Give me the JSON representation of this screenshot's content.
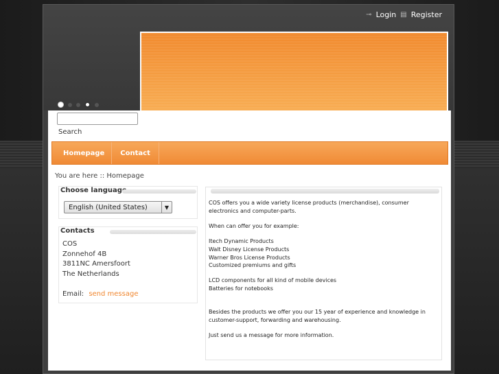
{
  "toplinks": {
    "login": "Login",
    "register": "Register"
  },
  "search": {
    "label": "Search",
    "placeholder": ""
  },
  "nav": {
    "items": [
      "Homepage",
      "Contact"
    ]
  },
  "breadcrumb": {
    "text": "You are here :: Homepage"
  },
  "language": {
    "title": "Choose language",
    "selected": "English (United States)"
  },
  "contacts": {
    "title": "Contacts",
    "lines": [
      "COS",
      "Zonnehof 4B",
      "3811NC  Amersfoort",
      "The Netherlands"
    ],
    "email_label": "Email:",
    "email_link": "send message"
  },
  "main": {
    "paragraphs": [
      "COS offers you a wide variety license products (merchandise), consumer electronics and computer-parts.",
      "When can offer you for example:",
      "Itech Dynamic Products",
      "Walt Disney License Products",
      "Warner Bros License Products",
      "Customized premiums and gifts",
      "LCD components for all kind of mobile devices",
      "Batteries for notebooks",
      "Besides the products we offer you our 15 year of experience and knowledge in customer-support, forwarding and  warehousing.",
      "Just send us a message for more information."
    ]
  },
  "colors": {
    "accent": "#f08a35",
    "link": "#f0862e"
  }
}
